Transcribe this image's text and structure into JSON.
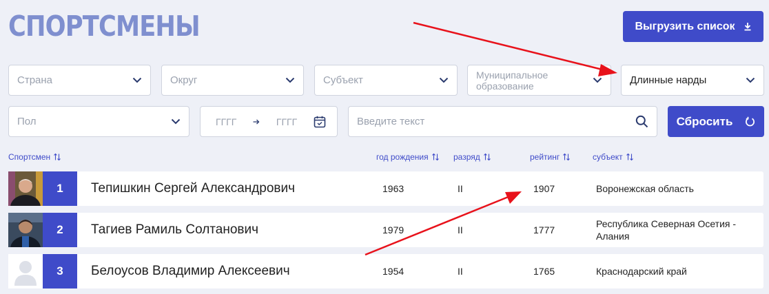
{
  "header": {
    "title": "СПОРТСМЕНЫ",
    "export_label": "Выгрузить список"
  },
  "filters": {
    "country": "Страна",
    "district": "Округ",
    "subject": "Субъект",
    "municipal": "Муниципальное образование",
    "discipline": "Длинные нарды",
    "gender": "Пол",
    "year_from": "ГГГГ",
    "year_to": "ГГГГ",
    "search_placeholder": "Введите текст",
    "reset_label": "Сбросить"
  },
  "table": {
    "columns": {
      "athlete": "Спортсмен",
      "birth_year": "год рождения",
      "rank": "разряд",
      "rating": "рейтинг",
      "subject": "субъект"
    },
    "rows": [
      {
        "place": "1",
        "name": "Тепишкин Сергей Александрович",
        "birth_year": "1963",
        "rank": "II",
        "rating": "1907",
        "subject": "Воронежская область",
        "photo": "photo"
      },
      {
        "place": "2",
        "name": "Тагиев Рамиль Солтанович",
        "birth_year": "1979",
        "rank": "II",
        "rating": "1777",
        "subject": "Республика Северная Осетия - Алания",
        "photo": "photo"
      },
      {
        "place": "3",
        "name": "Белоусов Владимир Алексеевич",
        "birth_year": "1954",
        "rank": "II",
        "rating": "1765",
        "subject": "Краснодарский край",
        "photo": "placeholder-avatar"
      }
    ]
  },
  "colors": {
    "accent": "#3f4bc9",
    "title": "#7f8fcf",
    "background": "#eef0f7",
    "annotation_arrow": "#e8121b"
  },
  "icons": [
    "download-icon",
    "chevron-down-icon",
    "arrow-right-icon",
    "calendar-icon",
    "search-icon",
    "refresh-icon",
    "sort-icon",
    "user-avatar-icon"
  ]
}
